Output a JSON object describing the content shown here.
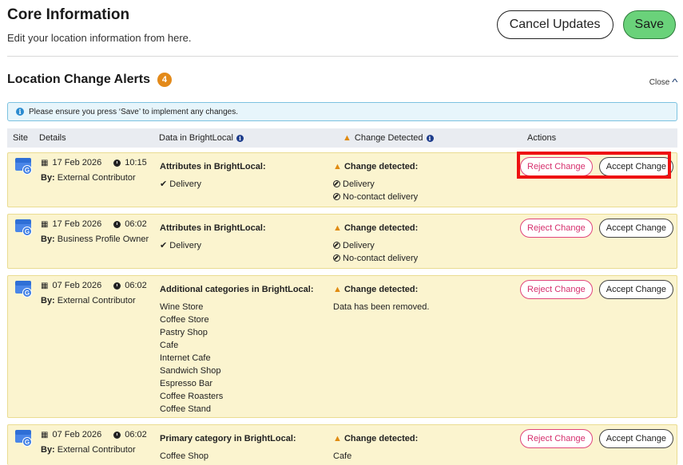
{
  "header": {
    "title": "Core Information",
    "subtitle": "Edit your location information from here.",
    "cancel_label": "Cancel Updates",
    "save_label": "Save"
  },
  "alerts": {
    "title": "Location Change Alerts",
    "count": "4",
    "close_label": "Close",
    "notice": "Please ensure you press ‘Save’ to implement any changes."
  },
  "table": {
    "columns": {
      "site": "Site",
      "details": "Details",
      "data": "Data in BrightLocal",
      "change": "Change Detected",
      "actions": "Actions"
    },
    "reject_label": "Reject Change",
    "accept_label": "Accept Change",
    "rows": [
      {
        "date": "17 Feb 2026",
        "time": "10:15",
        "by_prefix": "By:",
        "by": "External Contributor",
        "data_heading": "Attributes in BrightLocal:",
        "data_items": [
          "Delivery"
        ],
        "change_heading": "Change detected:",
        "change_items": [
          "Delivery",
          "No-contact delivery"
        ]
      },
      {
        "date": "17 Feb 2026",
        "time": "06:02",
        "by_prefix": "By:",
        "by": "Business Profile Owner",
        "data_heading": "Attributes in BrightLocal:",
        "data_items": [
          "Delivery"
        ],
        "change_heading": "Change detected:",
        "change_items": [
          "Delivery",
          "No-contact delivery"
        ]
      },
      {
        "date": "07 Feb 2026",
        "time": "06:02",
        "by_prefix": "By:",
        "by": "External Contributor",
        "data_heading": "Additional categories in BrightLocal:",
        "data_items": [
          "Wine Store",
          "Coffee Store",
          "Pastry Shop",
          "Cafe",
          "Internet Cafe",
          "Sandwich Shop",
          "Espresso Bar",
          "Coffee Roasters",
          "Coffee Stand"
        ],
        "change_heading": "Change detected:",
        "change_text": "Data has been removed."
      },
      {
        "date": "07 Feb 2026",
        "time": "06:02",
        "by_prefix": "By:",
        "by": "External Contributor",
        "data_heading": "Primary category in BrightLocal:",
        "data_items": [
          "Coffee Shop"
        ],
        "change_heading": "Change detected:",
        "change_text": "Cafe"
      }
    ]
  },
  "icons": {
    "site": "google-business-profile-icon",
    "date": "calendar-icon",
    "time": "clock-icon",
    "check": "checkmark-icon",
    "removed": "prohibited-icon",
    "warning": "warning-triangle-icon",
    "info": "info-icon",
    "close": "chevron-up-icon"
  },
  "colors": {
    "row_bg": "#fbf4cf",
    "save_bg": "#6ad27a",
    "reject": "#d62f6d",
    "badge": "#e38a1a",
    "highlight": "#ee1111"
  }
}
